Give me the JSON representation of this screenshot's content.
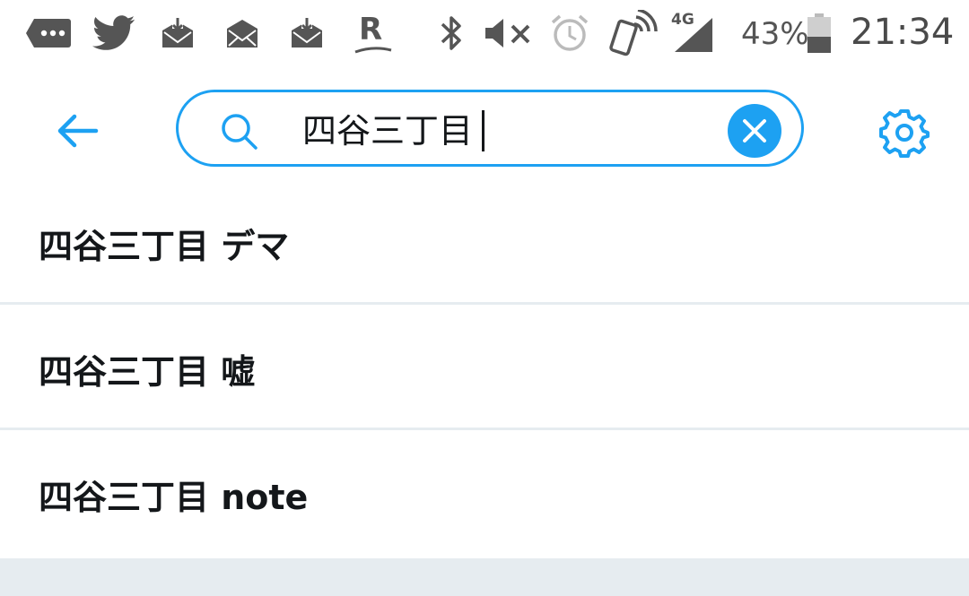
{
  "status_bar": {
    "icons": [
      "message-icon",
      "twitter-icon",
      "mail-download-icon",
      "mail-icon",
      "mail-download-icon",
      "rakuten-icon",
      "bluetooth-icon",
      "mute-icon",
      "alarm-icon",
      "nfc-icon",
      "signal-4g-icon",
      "battery-icon"
    ],
    "rakuten_letter": "R",
    "network_label": "4G",
    "battery_percent": "43%",
    "battery_level": 0.43,
    "clock": "21:34"
  },
  "header": {
    "back_icon": "back-arrow-icon",
    "search": {
      "value": "四谷三丁目",
      "icon": "search-icon"
    },
    "clear_icon": "close-icon",
    "settings_icon": "gear-icon"
  },
  "suggestions": [
    {
      "label": "四谷三丁目 デマ"
    },
    {
      "label": "四谷三丁目 嘘"
    },
    {
      "label": "四谷三丁目 note"
    }
  ],
  "colors": {
    "accent": "#1da1f2",
    "text": "#14171a",
    "status_icon": "#555555",
    "divider": "#e6ecf0"
  }
}
